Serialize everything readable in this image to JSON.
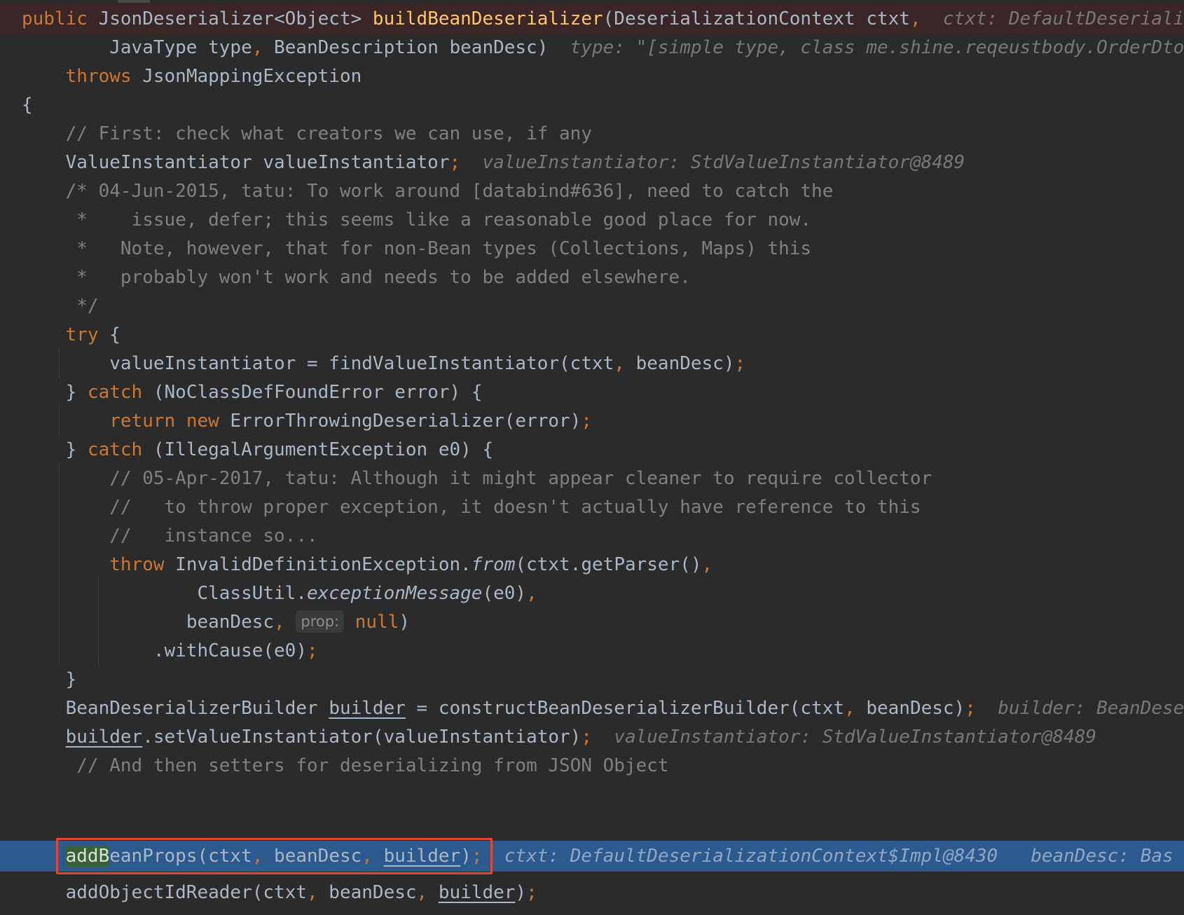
{
  "code": {
    "l01": {
      "kw": "public",
      "type": "JsonDeserializer<Object>",
      "method": "buildBeanDeserializer",
      "params": "(DeserializationContext ctxt",
      "comma": ",",
      "hint": "ctxt: DefaultDeseriali"
    },
    "l02": {
      "indent": "        ",
      "params": "JavaType type",
      "comma": ",",
      "params2": " BeanDescription beanDesc)",
      "hint": "type: \"[simple type, class me.shine.reqeustbody.OrderDto"
    },
    "l03": {
      "indent": "    ",
      "kw": "throws",
      "text": " JsonMappingException"
    },
    "l04": {
      "text": "{"
    },
    "l05": {
      "indent": "    ",
      "comment": "// First: check what creators we can use, if any"
    },
    "l06": {
      "indent": "    ",
      "text": "ValueInstantiator valueInstantiator",
      "semi": ";",
      "hint": "valueInstantiator: StdValueInstantiator@8489"
    },
    "l07": {
      "indent": "    ",
      "comment": "/* 04-Jun-2015, tatu: To work around [databind#636], need to catch the"
    },
    "l08": {
      "indent": "    ",
      "comment": " *    issue, defer; this seems like a reasonable good place for now."
    },
    "l09": {
      "indent": "    ",
      "comment": " *   Note, however, that for non-Bean types (Collections, Maps) this"
    },
    "l10": {
      "indent": "    ",
      "comment": " *   probably won't work and needs to be added elsewhere."
    },
    "l11": {
      "indent": "    ",
      "comment": " */"
    },
    "l12": {
      "indent": "    ",
      "kw": "try",
      "text": " {"
    },
    "l13": {
      "indent": "        ",
      "text": "valueInstantiator = findValueInstantiator(ctxt",
      "comma": ",",
      "text2": " beanDesc)",
      "semi": ";"
    },
    "l14": {
      "indent": "    ",
      "brace": "} ",
      "kw": "catch",
      "text": " (NoClassDefFoundError error) {"
    },
    "l15": {
      "indent": "        ",
      "kw": "return",
      "kw2": "new",
      "text": " ErrorThrowingDeserializer(error)",
      "semi": ";"
    },
    "l16": {
      "indent": "    ",
      "brace": "} ",
      "kw": "catch",
      "text": " (IllegalArgumentException e0) {"
    },
    "l17": {
      "indent": "        ",
      "comment": "// 05-Apr-2017, tatu: Although it might appear cleaner to require collector"
    },
    "l18": {
      "indent": "        ",
      "comment": "//   to throw proper exception, it doesn't actually have reference to this"
    },
    "l19": {
      "indent": "        ",
      "comment": "//   instance so..."
    },
    "l20": {
      "indent": "        ",
      "kw": "throw",
      "text": " InvalidDefinitionException.",
      "italic": "from",
      "text2": "(ctxt.getParser()",
      "comma": ","
    },
    "l21": {
      "indent": "                ",
      "text": "ClassUtil.",
      "italic": "exceptionMessage",
      "text2": "(e0)",
      "comma": ","
    },
    "l22": {
      "indent": "               ",
      "text": "beanDesc",
      "comma": ",",
      "param_hint": "prop:",
      "kw": "null",
      "text2": ")"
    },
    "l23": {
      "indent": "            ",
      "text": ".withCause(e0)",
      "semi": ";"
    },
    "l24": {
      "indent": "    ",
      "text": "}"
    },
    "l25": {
      "indent": "    ",
      "text": "BeanDeserializerBuilder ",
      "var": "builder",
      "text2": " = constructBeanDeserializerBuilder(ctxt",
      "comma": ",",
      "text3": " beanDesc)",
      "semi": ";",
      "hint": "builder: BeanDese"
    },
    "l26": {
      "indent": "    ",
      "var": "builder",
      "text": ".setValueInstantiator(valueInstantiator)",
      "semi": ";",
      "hint": "valueInstantiator: StdValueInstantiator@8489"
    },
    "l27": {
      "indent": "     ",
      "comment": "// And then setters for deserializing from JSON Object"
    },
    "l28": {
      "indent": "    ",
      "highlight": "addB",
      "text": "eanProps(ctxt",
      "comma": ",",
      "text2": " beanDesc",
      "comma2": ",",
      "space": " ",
      "var": "builder",
      "text3": ")",
      "semi": ";",
      "hint": "ctxt: DefaultDeserializationContext$Impl@8430",
      "hint2": "beanDesc: Bas"
    },
    "l29": {
      "indent": "    ",
      "text": "addObjectIdReader(ctxt",
      "comma": ",",
      "text2": " beanDesc",
      "comma2": ",",
      "space": " ",
      "var": "builder",
      "text3": ")",
      "semi": ";"
    }
  }
}
